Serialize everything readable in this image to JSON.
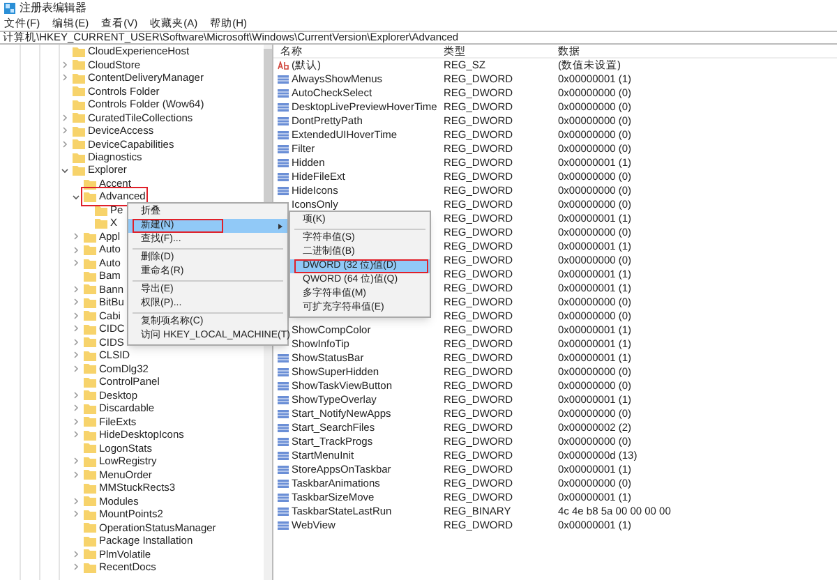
{
  "window": {
    "title": "注册表编辑器"
  },
  "menu": [
    "文件(F)",
    "编辑(E)",
    "查看(V)",
    "收藏夹(A)",
    "帮助(H)"
  ],
  "address": "计算机\\HKEY_CURRENT_USER\\Software\\Microsoft\\Windows\\CurrentVersion\\Explorer\\Advanced",
  "tree": [
    {
      "label": "CloudExperienceHost"
    },
    {
      "label": "CloudStore",
      "expanded": false
    },
    {
      "label": "ContentDeliveryManager",
      "expanded": false
    },
    {
      "label": "Controls Folder"
    },
    {
      "label": "Controls Folder (Wow64)"
    },
    {
      "label": "CuratedTileCollections",
      "expanded": false
    },
    {
      "label": "DeviceAccess",
      "expanded": false
    },
    {
      "label": "DeviceCapabilities",
      "expanded": false
    },
    {
      "label": "Diagnostics"
    },
    {
      "label": "Explorer",
      "expanded": true,
      "children": [
        {
          "label": "Accent"
        },
        {
          "label": "Advanced",
          "expanded": true,
          "annotated": true,
          "children": [
            {
              "label": "Pe"
            },
            {
              "label": "X"
            }
          ]
        },
        {
          "label": "Appl",
          "expanded": false
        },
        {
          "label": "Auto",
          "expanded": false
        },
        {
          "label": "Auto",
          "expanded": false
        },
        {
          "label": "Bam"
        },
        {
          "label": "Bann",
          "expanded": false
        },
        {
          "label": "BitBu",
          "expanded": false
        },
        {
          "label": "Cabi",
          "expanded": false
        },
        {
          "label": "CIDC",
          "expanded": false
        },
        {
          "label": "CIDS",
          "expanded": false
        },
        {
          "label": "CLSID",
          "expanded": false
        },
        {
          "label": "ComDlg32",
          "expanded": false
        },
        {
          "label": "ControlPanel"
        },
        {
          "label": "Desktop",
          "expanded": false
        },
        {
          "label": "Discardable",
          "expanded": false
        },
        {
          "label": "FileExts",
          "expanded": false
        },
        {
          "label": "HideDesktopIcons",
          "expanded": false
        },
        {
          "label": "LogonStats"
        },
        {
          "label": "LowRegistry",
          "expanded": false
        },
        {
          "label": "MenuOrder",
          "expanded": false
        },
        {
          "label": "MMStuckRects3"
        },
        {
          "label": "Modules",
          "expanded": false
        },
        {
          "label": "MountPoints2",
          "expanded": false
        },
        {
          "label": "OperationStatusManager"
        },
        {
          "label": "Package Installation"
        },
        {
          "label": "PlmVolatile",
          "expanded": false
        },
        {
          "label": "RecentDocs",
          "expanded": false
        }
      ]
    }
  ],
  "table": {
    "columns": [
      "名称",
      "类型",
      "数据"
    ],
    "rows": [
      {
        "kind": "string",
        "name": "(默认)",
        "type": "REG_SZ",
        "data": "(数值未设置)"
      },
      {
        "kind": "number",
        "name": "AlwaysShowMenus",
        "type": "REG_DWORD",
        "data": "0x00000001 (1)"
      },
      {
        "kind": "number",
        "name": "AutoCheckSelect",
        "type": "REG_DWORD",
        "data": "0x00000000 (0)"
      },
      {
        "kind": "number",
        "name": "DesktopLivePreviewHoverTime",
        "type": "REG_DWORD",
        "data": "0x00000000 (0)"
      },
      {
        "kind": "number",
        "name": "DontPrettyPath",
        "type": "REG_DWORD",
        "data": "0x00000000 (0)"
      },
      {
        "kind": "number",
        "name": "ExtendedUIHoverTime",
        "type": "REG_DWORD",
        "data": "0x00000000 (0)"
      },
      {
        "kind": "number",
        "name": "Filter",
        "type": "REG_DWORD",
        "data": "0x00000000 (0)"
      },
      {
        "kind": "number",
        "name": "Hidden",
        "type": "REG_DWORD",
        "data": "0x00000001 (1)"
      },
      {
        "kind": "number",
        "name": "HideFileExt",
        "type": "REG_DWORD",
        "data": "0x00000000 (0)"
      },
      {
        "kind": "number",
        "name": "HideIcons",
        "type": "REG_DWORD",
        "data": "0x00000000 (0)"
      },
      {
        "kind": "hidden",
        "name": "IconsOnly",
        "type": "REG_DWORD",
        "data": "0x00000000 (0)"
      },
      {
        "kind": "hidden",
        "type": "REG_DWORD",
        "data": "0x00000001 (1)"
      },
      {
        "kind": "hidden",
        "type": "REG_DWORD",
        "data": "0x00000000 (0)"
      },
      {
        "kind": "hidden",
        "type": "REG_DWORD",
        "data": "0x00000001 (1)"
      },
      {
        "kind": "hidden",
        "type": "REG_DWORD",
        "data": "0x00000000 (0)"
      },
      {
        "kind": "hidden",
        "type": "REG_DWORD",
        "data": "0x00000001 (1)"
      },
      {
        "kind": "hidden",
        "type": "REG_DWORD",
        "data": "0x00000001 (1)"
      },
      {
        "kind": "hidden",
        "type": "REG_DWORD",
        "data": "0x00000000 (0)"
      },
      {
        "kind": "hidden",
        "type": "REG_DWORD",
        "data": "0x00000000 (0)"
      },
      {
        "kind": "hidden",
        "name": "ShowCompColor",
        "type": "REG_DWORD",
        "data": "0x00000001 (1)"
      },
      {
        "kind": "hidden",
        "name": "ShowInfoTip",
        "type": "REG_DWORD",
        "data": "0x00000001 (1)"
      },
      {
        "kind": "number",
        "name": "ShowStatusBar",
        "type": "REG_DWORD",
        "data": "0x00000001 (1)"
      },
      {
        "kind": "number",
        "name": "ShowSuperHidden",
        "type": "REG_DWORD",
        "data": "0x00000000 (0)"
      },
      {
        "kind": "number",
        "name": "ShowTaskViewButton",
        "type": "REG_DWORD",
        "data": "0x00000000 (0)"
      },
      {
        "kind": "number",
        "name": "ShowTypeOverlay",
        "type": "REG_DWORD",
        "data": "0x00000001 (1)"
      },
      {
        "kind": "number",
        "name": "Start_NotifyNewApps",
        "type": "REG_DWORD",
        "data": "0x00000000 (0)"
      },
      {
        "kind": "number",
        "name": "Start_SearchFiles",
        "type": "REG_DWORD",
        "data": "0x00000002 (2)"
      },
      {
        "kind": "number",
        "name": "Start_TrackProgs",
        "type": "REG_DWORD",
        "data": "0x00000000 (0)"
      },
      {
        "kind": "number",
        "name": "StartMenuInit",
        "type": "REG_DWORD",
        "data": "0x0000000d (13)"
      },
      {
        "kind": "number",
        "name": "StoreAppsOnTaskbar",
        "type": "REG_DWORD",
        "data": "0x00000001 (1)"
      },
      {
        "kind": "number",
        "name": "TaskbarAnimations",
        "type": "REG_DWORD",
        "data": "0x00000000 (0)"
      },
      {
        "kind": "number",
        "name": "TaskbarSizeMove",
        "type": "REG_DWORD",
        "data": "0x00000001 (1)"
      },
      {
        "kind": "number",
        "name": "TaskbarStateLastRun",
        "type": "REG_BINARY",
        "data": "4c 4e b8 5a 00 00 00 00"
      },
      {
        "kind": "number",
        "name": "WebView",
        "type": "REG_DWORD",
        "data": "0x00000001 (1)"
      }
    ]
  },
  "context_menu": {
    "items": [
      {
        "kind": "item",
        "label": "折叠",
        "selected": false
      },
      {
        "kind": "submenu",
        "label": "新建(N)",
        "selected": true,
        "annotated": true
      },
      {
        "kind": "item",
        "label": "查找(F)...",
        "selected": false
      },
      {
        "kind": "separator"
      },
      {
        "kind": "item",
        "label": "删除(D)",
        "selected": false
      },
      {
        "kind": "item",
        "label": "重命名(R)",
        "selected": false
      },
      {
        "kind": "separator"
      },
      {
        "kind": "item",
        "label": "导出(E)",
        "selected": false
      },
      {
        "kind": "item",
        "label": "权限(P)...",
        "selected": false
      },
      {
        "kind": "separator"
      },
      {
        "kind": "item",
        "label": "复制项名称(C)",
        "selected": false
      },
      {
        "kind": "item",
        "label": "访问 HKEY_LOCAL_MACHINE(T)",
        "selected": false
      }
    ]
  },
  "submenu": {
    "items": [
      {
        "kind": "item",
        "label": "项(K)",
        "selected": false
      },
      {
        "kind": "separator"
      },
      {
        "kind": "item",
        "label": "字符串值(S)",
        "selected": false
      },
      {
        "kind": "item",
        "label": "二进制值(B)",
        "selected": false
      },
      {
        "kind": "item",
        "label": "DWORD (32 位)值(D)",
        "selected": true,
        "annotated": true
      },
      {
        "kind": "item",
        "label": "QWORD (64 位)值(Q)",
        "selected": false
      },
      {
        "kind": "item",
        "label": "多字符串值(M)",
        "selected": false
      },
      {
        "kind": "item",
        "label": "可扩充字符串值(E)",
        "selected": false
      }
    ]
  }
}
